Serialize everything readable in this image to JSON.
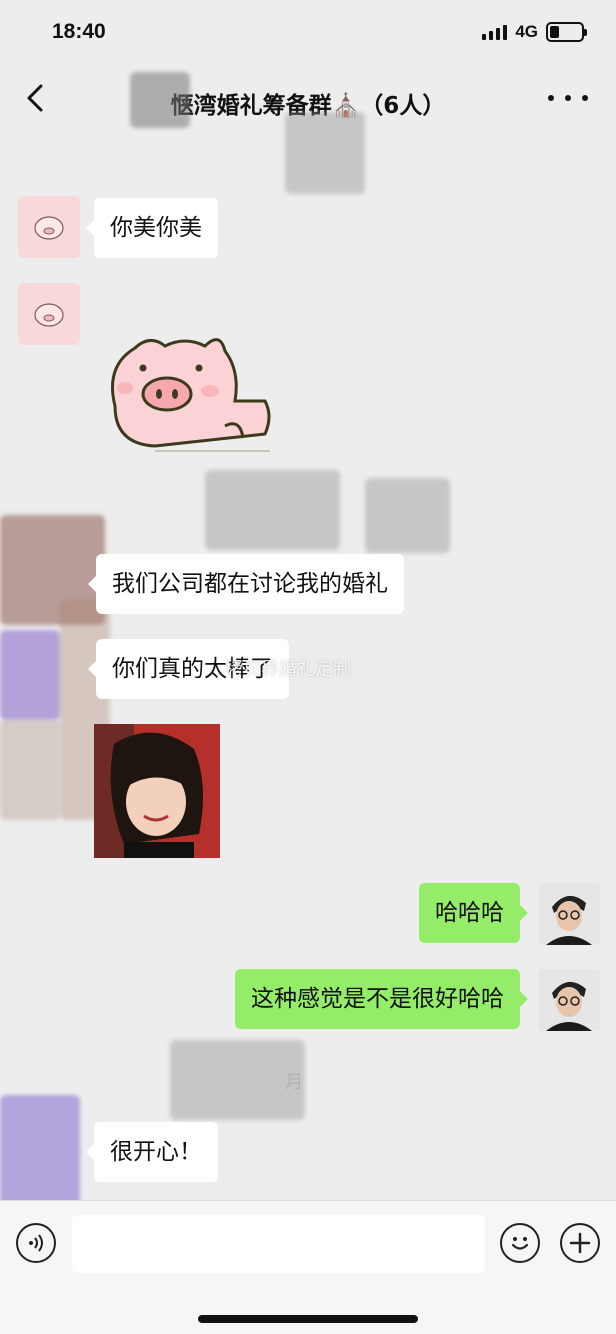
{
  "status_bar": {
    "time": "18:40",
    "network": "4G",
    "battery_level": 0.3
  },
  "nav": {
    "title": "惬湾婚礼筹备群⛪️（6人）",
    "back_icon": "chevron-left-icon",
    "more_icon": "more-dots-icon"
  },
  "messages": [
    {
      "side": "left",
      "sender": "pig-avatar",
      "text": "你美你美"
    },
    {
      "side": "left",
      "sender": "pig-avatar",
      "type": "sticker",
      "sticker": "pig-sticker"
    },
    {
      "side": "left",
      "sender": "redacted",
      "text": "我们公司都在讨论我的婚礼"
    },
    {
      "side": "left",
      "sender": "redacted",
      "text": "你们真的太棒了"
    },
    {
      "side": "left",
      "sender": "redacted",
      "type": "image",
      "image": "girl-photo"
    },
    {
      "side": "right",
      "sender": "self",
      "text": "哈哈哈"
    },
    {
      "side": "right",
      "sender": "self",
      "text": "这种感觉是不是很好哈哈"
    },
    {
      "side": "left",
      "sender": "redacted",
      "text": "很开心！"
    }
  ],
  "watermark": "拷贝界婚礼定制",
  "faint_timestamp": "月",
  "input_bar": {
    "placeholder": "",
    "voice_icon": "voice-icon",
    "emoji_icon": "emoji-icon",
    "plus_icon": "plus-icon"
  },
  "colors": {
    "background": "#ededed",
    "bubble_self": "#95ec69",
    "bubble_other": "#ffffff"
  }
}
